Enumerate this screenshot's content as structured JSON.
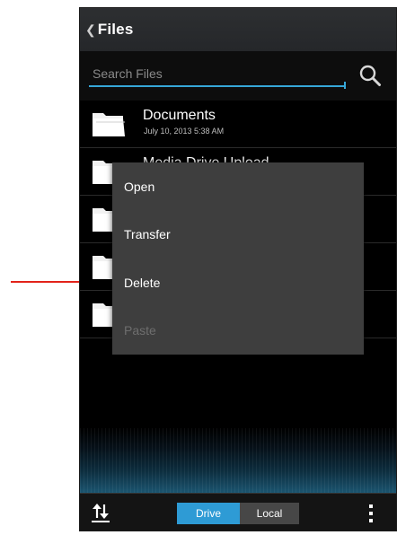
{
  "colors": {
    "accent": "#2e9bd5",
    "callout_arrow": "#e2231a",
    "menu_bg": "#3e3e3e"
  },
  "header": {
    "back_icon": "chevron-left-icon",
    "title": "Files"
  },
  "search": {
    "placeholder": "Search Files",
    "icon": "search-icon"
  },
  "files": [
    {
      "name": "Documents",
      "date": "July 10, 2013 5:38 AM",
      "icon": "folder-icon"
    },
    {
      "name": "Media Drive Upload",
      "date": "",
      "icon": "folder-icon"
    },
    {
      "name": "",
      "date": "",
      "icon": "folder-icon"
    },
    {
      "name": "",
      "date": "",
      "icon": "folder-icon"
    },
    {
      "name": "",
      "date": "",
      "icon": "folder-icon"
    }
  ],
  "context_menu": {
    "items": [
      {
        "label": "Open",
        "enabled": true
      },
      {
        "label": "Transfer",
        "enabled": true
      },
      {
        "label": "Delete",
        "enabled": true
      },
      {
        "label": "Paste",
        "enabled": false
      }
    ]
  },
  "bottom_bar": {
    "sort_icon": "sort-arrows-icon",
    "tabs": [
      {
        "label": "Drive",
        "selected": true
      },
      {
        "label": "Local",
        "selected": false
      }
    ],
    "overflow_icon": "overflow-menu-icon"
  }
}
